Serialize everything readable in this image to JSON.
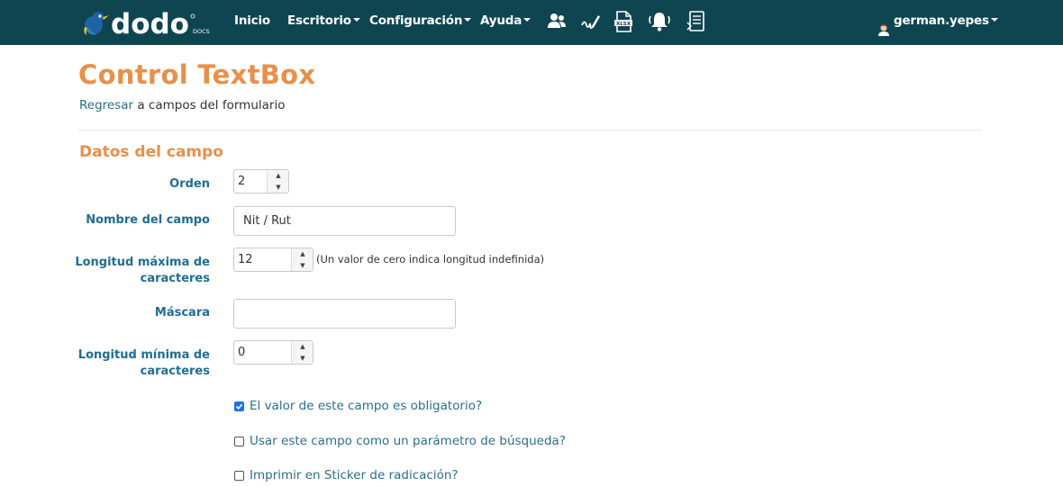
{
  "navbar": {
    "logo_text": "dodo",
    "logo_sub": "DOCS",
    "items": [
      {
        "label": "Inicio"
      },
      {
        "label": "Escritorio"
      },
      {
        "label": "Configuración"
      },
      {
        "label": "Ayuda"
      }
    ],
    "user": "german.yepes",
    "icons": [
      "users-icon",
      "signature-icon",
      "xlsx-file-icon",
      "bell-icon",
      "document-icon"
    ]
  },
  "page": {
    "title": "Control TextBox",
    "breadcrumb_link": "Regresar",
    "breadcrumb_rest": " a campos del formulario"
  },
  "section": {
    "title": "Datos del campo"
  },
  "form": {
    "orden": {
      "label": "Orden",
      "value": "2"
    },
    "nombre": {
      "label": "Nombre del campo",
      "value": "Nit / Rut"
    },
    "long_max": {
      "label_line1": "Longitud máxima de",
      "label_line2": "caracteres",
      "value": "12",
      "hint": "(Un valor de cero indica longitud indefinida)"
    },
    "mascara": {
      "label": "Máscara",
      "value": ""
    },
    "long_min": {
      "label_line1": "Longitud mínima de",
      "label_line2": "caracteres",
      "value": "0"
    },
    "checks": [
      {
        "label": "El valor de este campo es obligatorio?",
        "checked": true
      },
      {
        "label": "Usar este campo como un parámetro de búsqueda?",
        "checked": false
      },
      {
        "label": "Imprimir en Sticker de radicación?",
        "checked": false
      }
    ]
  },
  "colors": {
    "navbar": "#0f4551",
    "accent_orange": "#e8904a",
    "label_blue": "#1f6d93",
    "link_blue": "#2a6e8a",
    "check_blue": "#1a73e8"
  }
}
